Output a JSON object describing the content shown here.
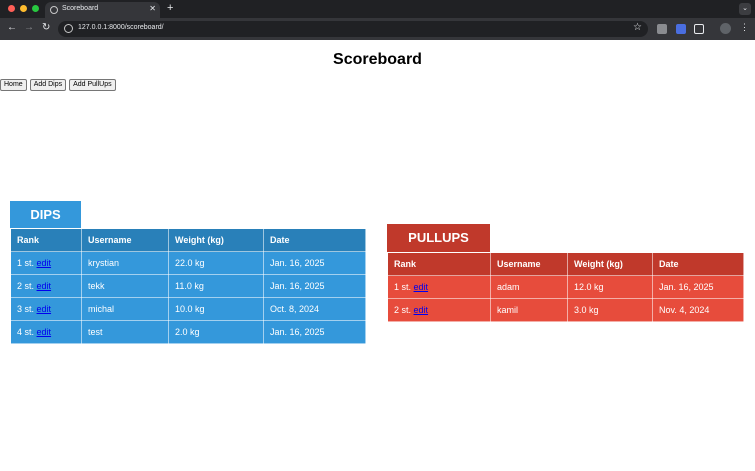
{
  "browser": {
    "tab_title": "Scoreboard",
    "tab_close": "✕",
    "new_tab": "+",
    "url": "127.0.0.1:8000/scoreboard/",
    "icons": [
      "back-icon",
      "forward-icon",
      "reload-icon",
      "site-info-icon",
      "star-icon",
      "extension-icon",
      "profile-icon",
      "menu-icon"
    ]
  },
  "page": {
    "title": "Scoreboard",
    "nav_buttons": [
      "Home",
      "Add Dips",
      "Add PullUps"
    ]
  },
  "columns": [
    "Rank",
    "Username",
    "Weight (kg)",
    "Date"
  ],
  "dips": {
    "title": "DIPS",
    "header_color": "#2980b9",
    "row_color": "#3498db",
    "rows": [
      {
        "rank": "1 st.",
        "edit": "edit",
        "username": "krystian",
        "weight": "22.0 kg",
        "date": "Jan. 16, 2025"
      },
      {
        "rank": "2 st.",
        "edit": "edit",
        "username": "tekk",
        "weight": "11.0 kg",
        "date": "Jan. 16, 2025"
      },
      {
        "rank": "3 st.",
        "edit": "edit",
        "username": "michal",
        "weight": "10.0 kg",
        "date": "Oct. 8, 2024"
      },
      {
        "rank": "4 st.",
        "edit": "edit",
        "username": "test",
        "weight": "2.0 kg",
        "date": "Jan. 16, 2025"
      }
    ]
  },
  "pullups": {
    "title": "PULLUPS",
    "header_color": "#c0392b",
    "row_color": "#e74c3c",
    "rows": [
      {
        "rank": "1 st.",
        "edit": "edit",
        "username": "adam",
        "weight": "12.0 kg",
        "date": "Jan. 16, 2025"
      },
      {
        "rank": "2 st.",
        "edit": "edit",
        "username": "kamil",
        "weight": "3.0 kg",
        "date": "Nov. 4, 2024"
      }
    ]
  }
}
